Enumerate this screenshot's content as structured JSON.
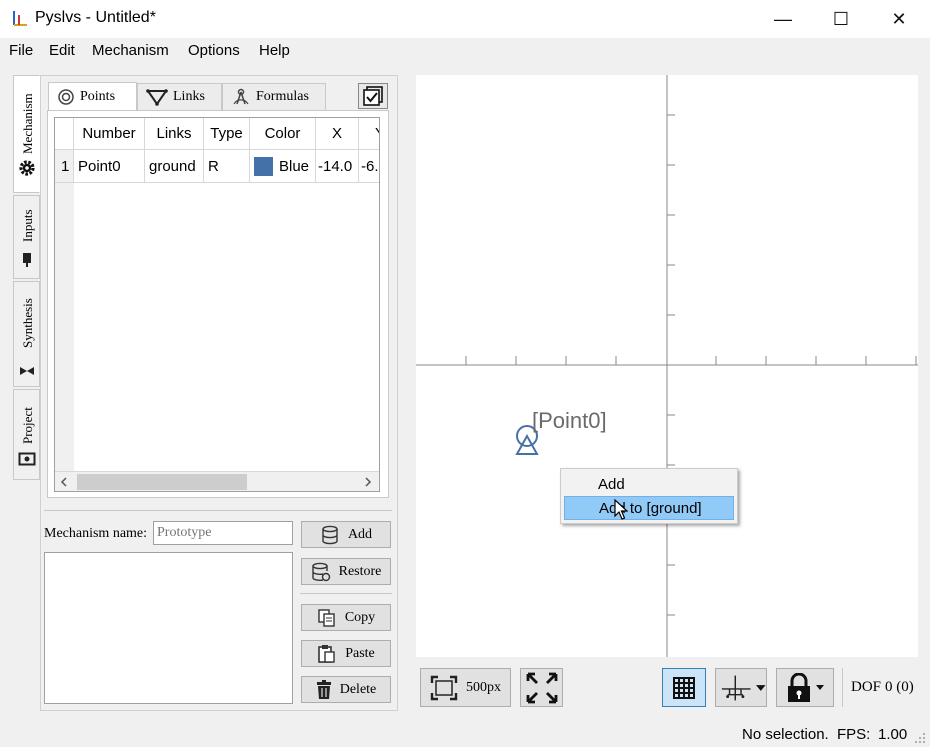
{
  "window": {
    "title": "Pyslvs - Untitled*",
    "controls": {
      "minimize": "—",
      "maximize": "☐",
      "close": "✕"
    }
  },
  "menubar": [
    "File",
    "Edit",
    "Mechanism",
    "Options",
    "Help"
  ],
  "side_tabs": [
    {
      "label": "Mechanism",
      "icon": "gear-icon",
      "active": true
    },
    {
      "label": "Inputs",
      "icon": "input-icon",
      "active": false
    },
    {
      "label": "Synthesis",
      "icon": "synthesis-icon",
      "active": false
    },
    {
      "label": "Project",
      "icon": "project-icon",
      "active": false
    }
  ],
  "tabs": [
    {
      "label": "Points",
      "icon": "points-icon",
      "active": true
    },
    {
      "label": "Links",
      "icon": "links-icon",
      "active": false
    },
    {
      "label": "Formulas",
      "icon": "formulas-icon",
      "active": false
    }
  ],
  "points_table": {
    "columns": [
      "Number",
      "Links",
      "Type",
      "Color",
      "X",
      "Y"
    ],
    "rows": [
      {
        "index": "1",
        "number": "Point0",
        "links": "ground",
        "type": "R",
        "color": "Blue",
        "color_hex": "#4472a8",
        "x": "-14.0",
        "y": "-6."
      }
    ]
  },
  "mechanism_name": {
    "label": "Mechanism name:",
    "placeholder": "Prototype"
  },
  "buttons": {
    "add": "Add",
    "restore": "Restore",
    "copy": "Copy",
    "paste": "Paste",
    "delete": "Delete"
  },
  "canvas": {
    "point_label": "[Point0]"
  },
  "context_menu": {
    "items": [
      "Add",
      "Add to [ground]"
    ],
    "highlighted": "Add to [ground]"
  },
  "toolbar": {
    "zoom_label": "500px",
    "dof_label": "DOF",
    "dof_value": "0 (0)"
  },
  "status": {
    "selection": "No selection.",
    "fps_label": "FPS:",
    "fps_value": "1.00"
  },
  "colors": {
    "accent": "#91c9f7",
    "point": "#4472a8",
    "selected_tool": "#cce4f7"
  }
}
